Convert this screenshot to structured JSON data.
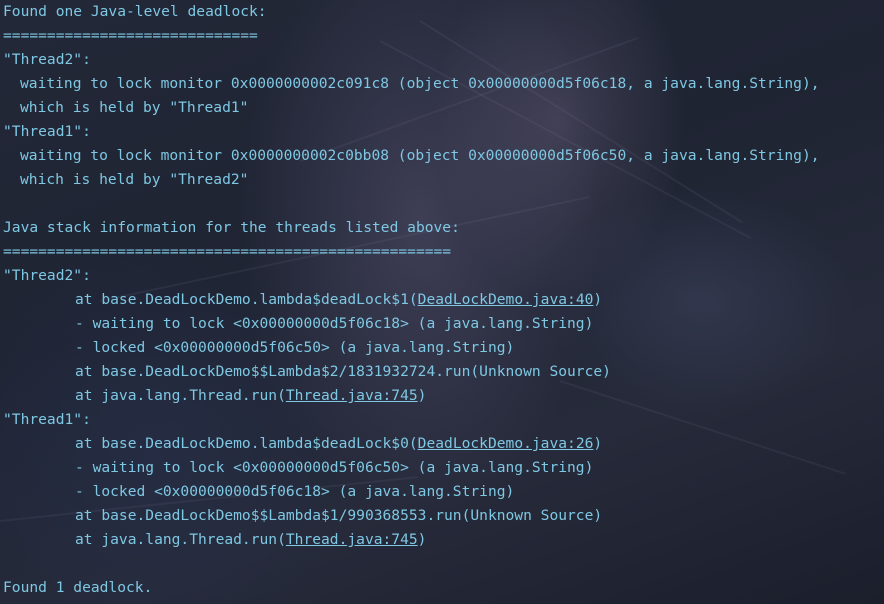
{
  "terminal": {
    "header": "Found one Java-level deadlock:",
    "divider1": "=============================",
    "t2_name": "\"Thread2\":",
    "t2_wait": "waiting to lock monitor 0x0000000002c091c8 (object 0x00000000d5f06c18, a java.lang.String),",
    "t2_held": "which is held by \"Thread1\"",
    "t1_name": "\"Thread1\":",
    "t1_wait": "waiting to lock monitor 0x0000000002c0bb08 (object 0x00000000d5f06c50, a java.lang.String),",
    "t1_held": "which is held by \"Thread2\"",
    "stack_header": "Java stack information for the threads listed above:",
    "divider2": "===================================================",
    "s2_name": "\"Thread2\":",
    "s2_f1_pre": "at base.DeadLockDemo.lambda$deadLock$1(",
    "s2_f1_link": "DeadLockDemo.java:40",
    "s2_f1_post": ")",
    "s2_waiting": "- waiting to lock <0x00000000d5f06c18> (a java.lang.String)",
    "s2_locked": "- locked <0x00000000d5f06c50> (a java.lang.String)",
    "s2_f2": "at base.DeadLockDemo$$Lambda$2/1831932724.run(Unknown Source)",
    "s2_f3_pre": "at java.lang.Thread.run(",
    "s2_f3_link": "Thread.java:745",
    "s2_f3_post": ")",
    "s1_name": "\"Thread1\":",
    "s1_f1_pre": "at base.DeadLockDemo.lambda$deadLock$0(",
    "s1_f1_link": "DeadLockDemo.java:26",
    "s1_f1_post": ")",
    "s1_waiting": "- waiting to lock <0x00000000d5f06c50> (a java.lang.String)",
    "s1_locked": "- locked <0x00000000d5f06c18> (a java.lang.String)",
    "s1_f2": "at base.DeadLockDemo$$Lambda$1/990368553.run(Unknown Source)",
    "s1_f3_pre": "at java.lang.Thread.run(",
    "s1_f3_link": "Thread.java:745",
    "s1_f3_post": ")",
    "footer": "Found 1 deadlock."
  },
  "colors": {
    "text": "#7ec8e3",
    "background": "#1c2130"
  }
}
